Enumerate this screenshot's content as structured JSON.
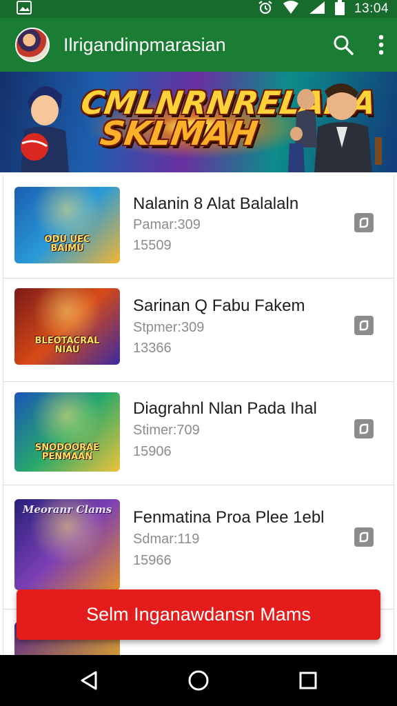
{
  "status_bar": {
    "time": "13:04",
    "icons": [
      "image-icon",
      "alarm-icon",
      "wifi-icon",
      "signal-icon",
      "battery-icon"
    ]
  },
  "app_bar": {
    "title": "Ilrigandinpmarasian",
    "icons": [
      "avatar",
      "search-icon",
      "more-vert-icon"
    ]
  },
  "banner": {
    "line1": "CMLNRNRELANA",
    "line2": "SKLMAH"
  },
  "games": [
    {
      "title": "Nalanin 8 Alat Balalaln",
      "meta1": "Pamar:309",
      "meta2": "15509",
      "thumb_label": "ODU UEC\nBAIMU",
      "thumb_top_label": "",
      "thumb_gradient": [
        "#1a5fb0",
        "#2a9ad8",
        "#f2b533"
      ]
    },
    {
      "title": "Sarinan Q Fabu Fakem",
      "meta1": "Stpmer:309",
      "meta2": "13366",
      "thumb_label": "BLEOTACRAL\nNIAU",
      "thumb_top_label": "",
      "thumb_gradient": [
        "#7a1a1a",
        "#d84a16",
        "#3b2aa0"
      ]
    },
    {
      "title": "Diagrahnl Nlan Pada Ihal",
      "meta1": "Stimer:709",
      "meta2": "15906",
      "thumb_label": "SNODOORAE\nPENMAAN",
      "thumb_top_label": "",
      "thumb_gradient": [
        "#1b55b8",
        "#27a96b",
        "#f0c23a"
      ]
    },
    {
      "title": "Fenmatina Proa Plee 1ebl",
      "meta1": "Sdmar:119",
      "meta2": "15966",
      "thumb_label": "",
      "thumb_top_label": "Meoranr Clams",
      "thumb_gradient": [
        "#26207a",
        "#7b3fb5",
        "#e3902a"
      ]
    }
  ],
  "cta": {
    "label": "Selm Inganawdansn Mams",
    "color": "#e51c1c"
  },
  "nav_bar": {
    "icons": [
      "back-icon",
      "home-icon",
      "recents-icon"
    ]
  },
  "colors": {
    "app_bar": "#1b7d33",
    "status_bar": "#176b2c",
    "accent": "#e51c1c"
  }
}
